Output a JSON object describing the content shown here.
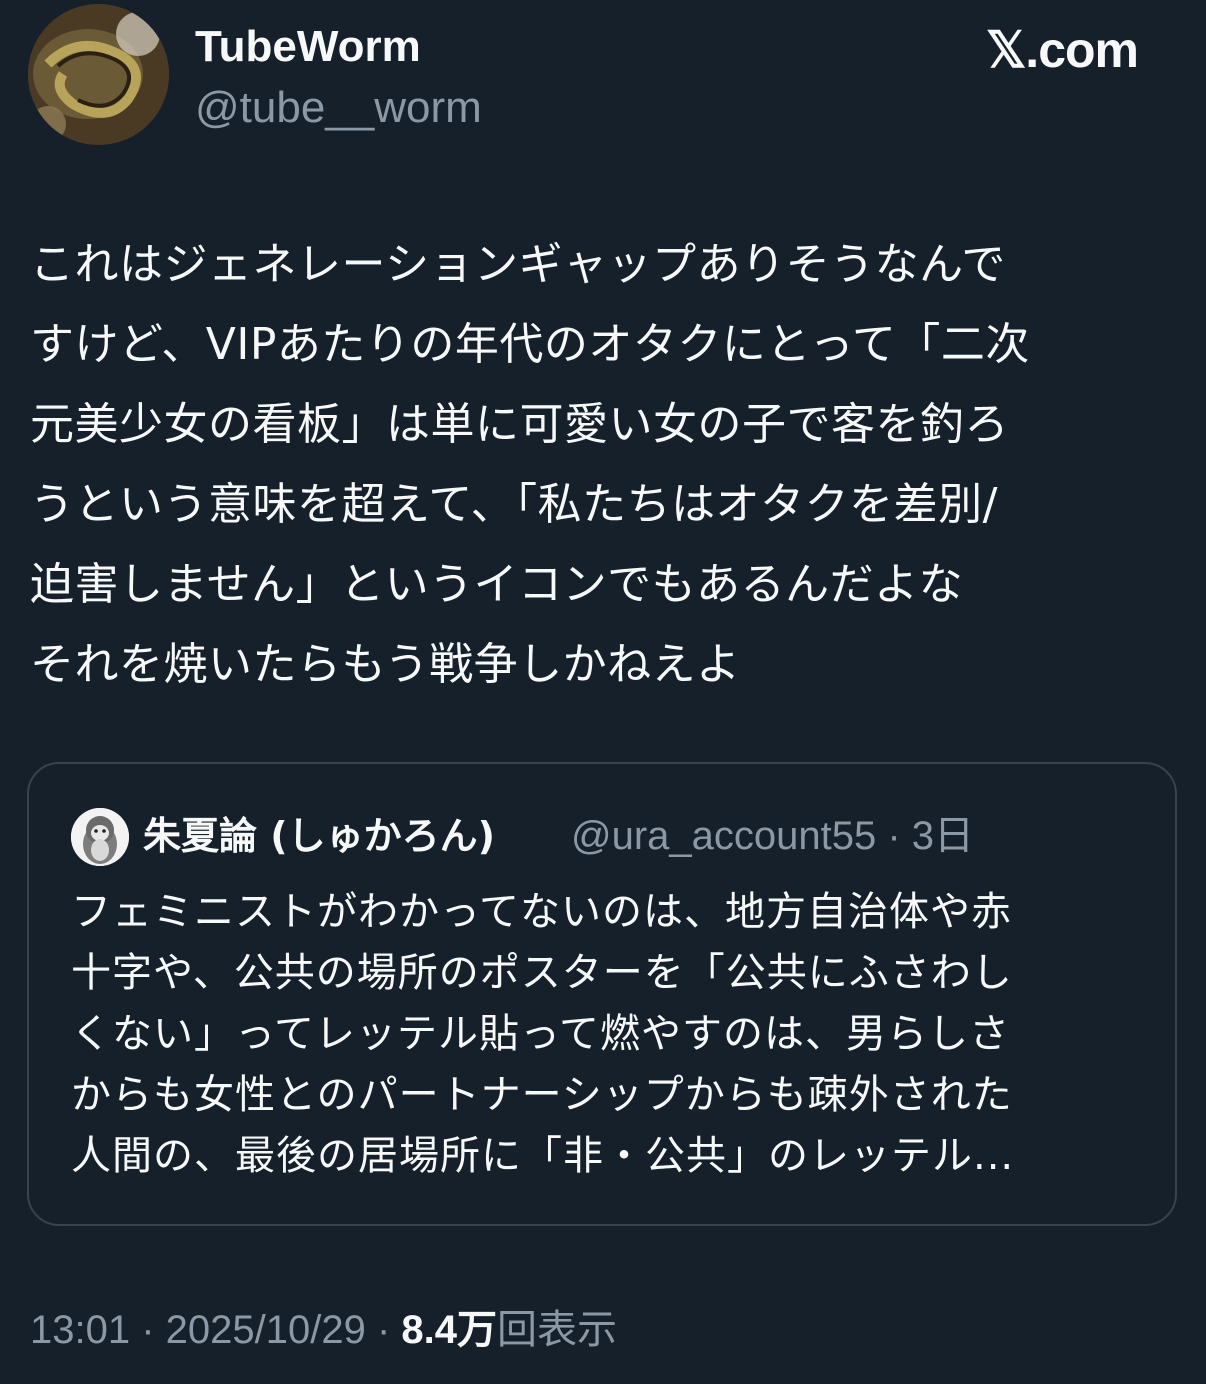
{
  "header": {
    "display_name": "TubeWorm",
    "handle": "@tube__worm",
    "brand": "𝕏.com"
  },
  "tweet": {
    "text": "これはジェネレーションギャップありそうなんで\nすけど、VIPあたりの年代のオタクにとって「二次\n元美少女の看板」は単に可愛い女の子で客を釣ろ\nうという意味を超えて、「私たちはオタクを差別/\n迫害しません」というイコンでもあるんだよな\nそれを焼いたらもう戦争しかねえよ"
  },
  "quote": {
    "display_name": "朱夏論 (しゅかろん)",
    "meta": "@ura_account55 · 3日",
    "text": "フェミニストがわかってないのは、地方自治体や赤\n十字や、公共の場所のポスターを「公共にふさわし\nくない」ってレッテル貼って燃やすのは、男らしさ\nからも女性とのパートナーシップからも疎外された\n人間の、最後の居場所に「非・公共」のレッテル..."
  },
  "footer": {
    "time_date": "13:01 · 2025/10/29 · ",
    "views_count": "8.4万",
    "views_label": "回表示"
  },
  "icons": {
    "profile_avatar": "tubeworm-photo-avatar",
    "quote_avatar": "penguin-avatar"
  },
  "colors": {
    "background": "#15202b",
    "text_primary": "#f7f9f9",
    "text_secondary": "#8b98a5",
    "border": "#38444d"
  }
}
